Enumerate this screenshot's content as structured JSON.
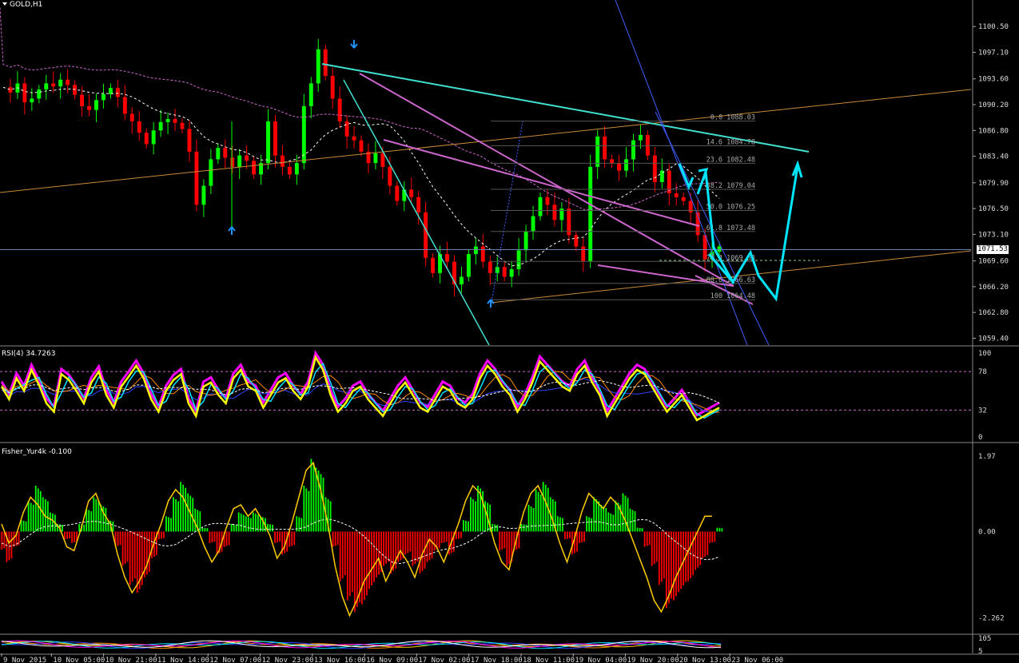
{
  "symbol_title": "GOLD,H1",
  "current_price": "1071.53",
  "colors": {
    "background": "#000000",
    "candle_up": "#00ff00",
    "candle_down": "#ff0000",
    "cyan": "#00e5ff",
    "trend_cyan": "#40e0d0",
    "violet": "#cc66cc",
    "orange": "#c88a3a",
    "blue": "#3f5fff",
    "rsi_main": "#ffff00",
    "fisher_line": "#ffcc00"
  },
  "chart_data": [
    {
      "type": "candlestick",
      "title": "GOLD,H1",
      "y_ticks": [
        "1100.50",
        "1097.10",
        "1093.60",
        "1090.20",
        "1086.80",
        "1083.40",
        "1079.90",
        "1076.50",
        "1073.10",
        "1069.60",
        "1066.20",
        "1062.80",
        "1059.40"
      ],
      "ylim": [
        1058.5,
        1104
      ],
      "x_ticks": [
        "9 Nov 2015",
        "10 Nov 05:00",
        "10 Nov 21:00",
        "11 Nov 14:00",
        "12 Nov 07:00",
        "12 Nov 23:00",
        "13 Nov 16:00",
        "16 Nov 09:00",
        "17 Nov 02:00",
        "17 Nov 18:00",
        "18 Nov 11:00",
        "19 Nov 04:00",
        "19 Nov 20:00",
        "20 Nov 13:00",
        "23 Nov 06:00"
      ],
      "close_path": [
        1092.5,
        1091.8,
        1093.0,
        1090.5,
        1091.0,
        1092.2,
        1093.0,
        1092.6,
        1093.5,
        1092.8,
        1091.5,
        1090.0,
        1089.5,
        1090.8,
        1091.6,
        1092.4,
        1091.2,
        1089.0,
        1088.0,
        1086.5,
        1085.0,
        1086.8,
        1087.9,
        1088.3,
        1087.8,
        1087.0,
        1084.0,
        1077.0,
        1079.5,
        1083.0,
        1084.5,
        1083.2,
        1082.0,
        1083.5,
        1082.8,
        1081.0,
        1082.5,
        1088.0,
        1083.5,
        1082.0,
        1081.0,
        1082.5,
        1090.0,
        1093.0,
        1097.5,
        1094.0,
        1091.0,
        1088.0,
        1086.0,
        1085.5,
        1084.0,
        1082.5,
        1083.8,
        1082.0,
        1079.5,
        1077.5,
        1079.0,
        1078.0,
        1076.0,
        1070.0,
        1068.0,
        1070.5,
        1069.5,
        1066.5,
        1067.5,
        1070.5,
        1071.5,
        1069.5,
        1068.0,
        1068.8,
        1067.5,
        1068.5,
        1071.0,
        1073.5,
        1075.5,
        1078.0,
        1077.0,
        1075.0,
        1076.5,
        1073.0,
        1071.5,
        1069.5,
        1082.0,
        1086.0,
        1083.0,
        1082.5,
        1081.5,
        1083.0,
        1085.5,
        1086.2,
        1083.5,
        1080.0,
        1081.5,
        1078.5,
        1078.0,
        1077.5,
        1076.0,
        1073.0,
        1069.8,
        1070.8,
        1071.5
      ],
      "highs": {
        "peak": "1098.0",
        "left_spike_low": "1073.8"
      },
      "fibonacci": [
        {
          "label": "0.0 1088.03",
          "price": 1088.03
        },
        {
          "label": "14.6 1084.78",
          "price": 1084.78
        },
        {
          "label": "23.6 1082.48",
          "price": 1082.48
        },
        {
          "label": "38.2 1079.04",
          "price": 1079.04
        },
        {
          "label": "50.0 1076.25",
          "price": 1076.25
        },
        {
          "label": "61.8 1073.48",
          "price": 1073.48
        },
        {
          "label": "76.4 1069.53",
          "price": 1069.53
        },
        {
          "label": "88.6 1066.63",
          "price": 1066.63
        },
        {
          "label": "100 1064.48",
          "price": 1064.48
        }
      ]
    },
    {
      "type": "line",
      "title": "RSI(4) 34.7263",
      "y_ticks": [
        "100",
        "78",
        "32",
        "0"
      ],
      "ylim": [
        0,
        100
      ],
      "series": [
        {
          "values": [
            60,
            45,
            70,
            55,
            80,
            62,
            40,
            30,
            75,
            68,
            55,
            40,
            65,
            78,
            50,
            35,
            60,
            72,
            85,
            70,
            45,
            30,
            55,
            68,
            75,
            40,
            25,
            60,
            65,
            50,
            40,
            70,
            80,
            60,
            55,
            35,
            50,
            65,
            70,
            55,
            45,
            60,
            95,
            80,
            50,
            30,
            40,
            55,
            60,
            45,
            35,
            25,
            40,
            55,
            65,
            50,
            35,
            30,
            45,
            60,
            55,
            40,
            35,
            45,
            70,
            85,
            75,
            60,
            50,
            30,
            45,
            65,
            90,
            80,
            70,
            60,
            55,
            75,
            85,
            65,
            50,
            25,
            40,
            55,
            70,
            80,
            75,
            60,
            45,
            30,
            40,
            50,
            35,
            20,
            25,
            30,
            35
          ]
        }
      ]
    },
    {
      "type": "bar",
      "title": "Fisher_Yur4k -0.100",
      "y_ticks": [
        "1.97",
        "0.00",
        "-2.262"
      ],
      "ylim": [
        -2.5,
        2.1
      ],
      "values": [
        -0.5,
        -0.8,
        -0.4,
        0.3,
        0.8,
        1.2,
        0.9,
        0.5,
        0.2,
        -0.2,
        -0.3,
        0.2,
        0.6,
        0.9,
        0.7,
        0.3,
        -0.4,
        -0.9,
        -1.4,
        -1.6,
        -1.2,
        -0.7,
        -0.2,
        0.4,
        0.9,
        1.3,
        1.0,
        0.6,
        0.1,
        -0.3,
        -0.6,
        -0.4,
        0.2,
        0.5,
        0.4,
        0.5,
        0.4,
        0.2,
        -0.3,
        -0.6,
        -0.4,
        0.4,
        1.2,
        1.9,
        1.6,
        0.9,
        -0.4,
        -1.3,
        -1.8,
        -2.1,
        -1.9,
        -1.5,
        -1.2,
        -0.9,
        -1.1,
        -0.8,
        -0.6,
        -0.9,
        -1.1,
        -0.8,
        -0.5,
        -0.3,
        -0.6,
        -0.2,
        0.3,
        0.9,
        1.2,
        0.8,
        0.2,
        -0.5,
        -0.9,
        -0.5,
        0.2,
        0.7,
        1.1,
        1.3,
        0.9,
        0.4,
        -0.2,
        -0.6,
        -0.3,
        0.4,
        0.9,
        0.7,
        0.5,
        0.8,
        1.0,
        0.6,
        0.1,
        -0.4,
        -0.9,
        -1.4,
        -2.0,
        -1.8,
        -1.5,
        -1.3,
        -1.0,
        -0.7,
        -0.3,
        0.1
      ],
      "signal": [
        0.2,
        -0.3,
        -0.1,
        0.5,
        0.9,
        0.7,
        0.4,
        0.3,
        0.1,
        -0.4,
        -0.5,
        0.1,
        0.8,
        1.0,
        0.5,
        0.2,
        -0.6,
        -1.2,
        -1.6,
        -1.3,
        -0.9,
        -0.3,
        0.2,
        0.8,
        1.1,
        0.9,
        0.5,
        0.1,
        -0.4,
        -0.8,
        -0.5,
        0.1,
        0.6,
        0.7,
        0.4,
        0.6,
        0.3,
        -0.1,
        -0.7,
        -0.4,
        0.2,
        0.9,
        1.6,
        1.8,
        1.1,
        0.2,
        -0.9,
        -1.7,
        -2.2,
        -1.8,
        -1.3,
        -1.0,
        -0.7,
        -1.3,
        -0.9,
        -0.5,
        -0.8,
        -1.2,
        -0.6,
        -0.2,
        -0.4,
        -0.8,
        -0.3,
        0.2,
        0.8,
        1.2,
        1.0,
        0.4,
        -0.3,
        -0.8,
        -1.0,
        -0.2,
        0.5,
        1.0,
        1.2,
        0.8,
        0.3,
        -0.3,
        -0.8,
        -0.2,
        0.5,
        1.0,
        0.8,
        0.6,
        0.9,
        0.7,
        0.3,
        -0.2,
        -0.7,
        -1.2,
        -1.8,
        -2.1,
        -1.7,
        -1.2,
        -0.8,
        -0.4,
        0.0,
        0.4,
        0.4
      ]
    },
    {
      "type": "line",
      "title": "",
      "y_ticks": [
        "105",
        "5"
      ],
      "ylim": [
        0,
        110
      ]
    }
  ]
}
